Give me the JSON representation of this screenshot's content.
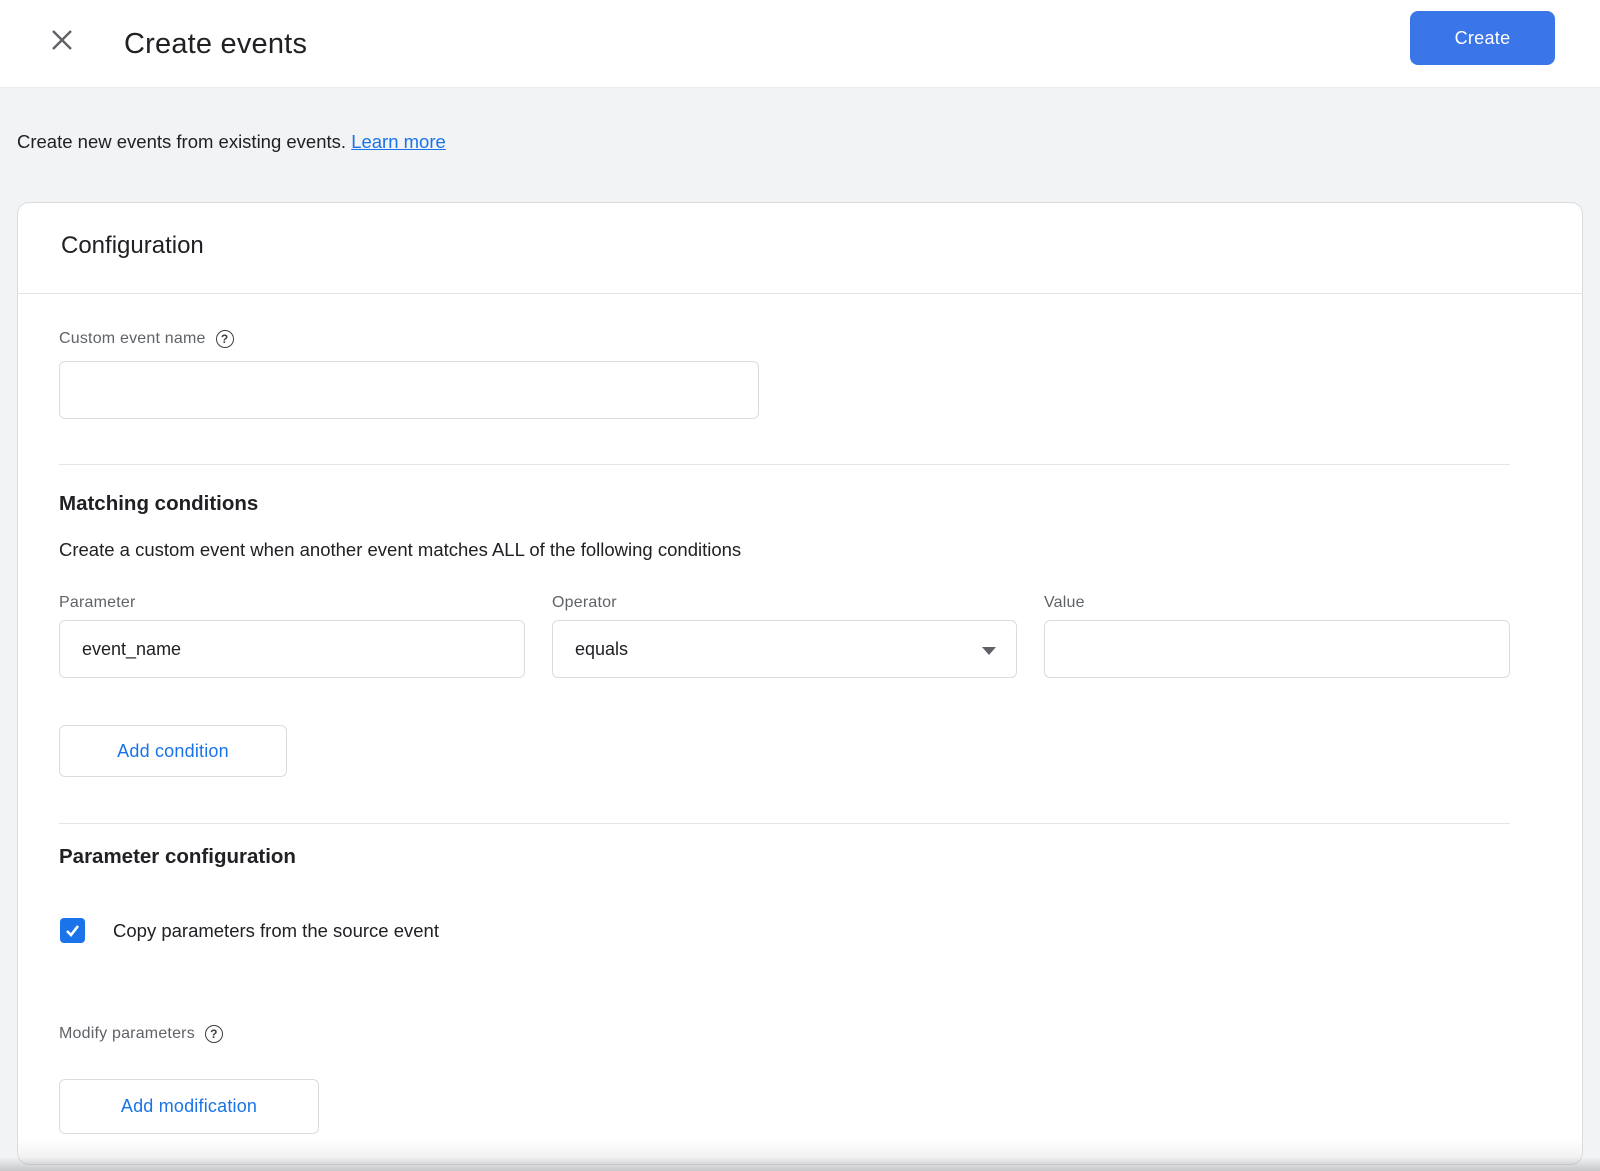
{
  "header": {
    "title": "Create events",
    "create_button_label": "Create"
  },
  "intro": {
    "text": "Create new events from existing events.",
    "link_label": "Learn more"
  },
  "card": {
    "title": "Configuration",
    "custom_event": {
      "label": "Custom event name",
      "value": "",
      "help_icon": "help-circle-icon"
    },
    "matching": {
      "title": "Matching conditions",
      "description": "Create a custom event when another event matches ALL of the following conditions",
      "parameter": {
        "label": "Parameter",
        "value": "event_name"
      },
      "operator": {
        "label": "Operator",
        "value": "equals"
      },
      "value": {
        "label": "Value",
        "value": ""
      },
      "add_condition_button_label": "Add condition"
    },
    "parameter_config": {
      "title": "Parameter configuration",
      "copy_checkbox": {
        "checked": true,
        "label": "Copy parameters from the source event"
      },
      "modify_label": "Modify parameters",
      "help_icon": "help-circle-icon",
      "add_modification_button_label": "Add modification"
    }
  },
  "icons": {
    "close": "close-x-icon",
    "dropdown": "caret-down-icon",
    "help": "question-mark-circle"
  },
  "colors": {
    "accent_link_blue": "#1a73e8",
    "primary_button_blue": "#3b76e8",
    "text_dark": "#202124",
    "label_gray": "#5f6368",
    "border_gray": "#dadce0",
    "page_background": "#f1f3f4"
  }
}
